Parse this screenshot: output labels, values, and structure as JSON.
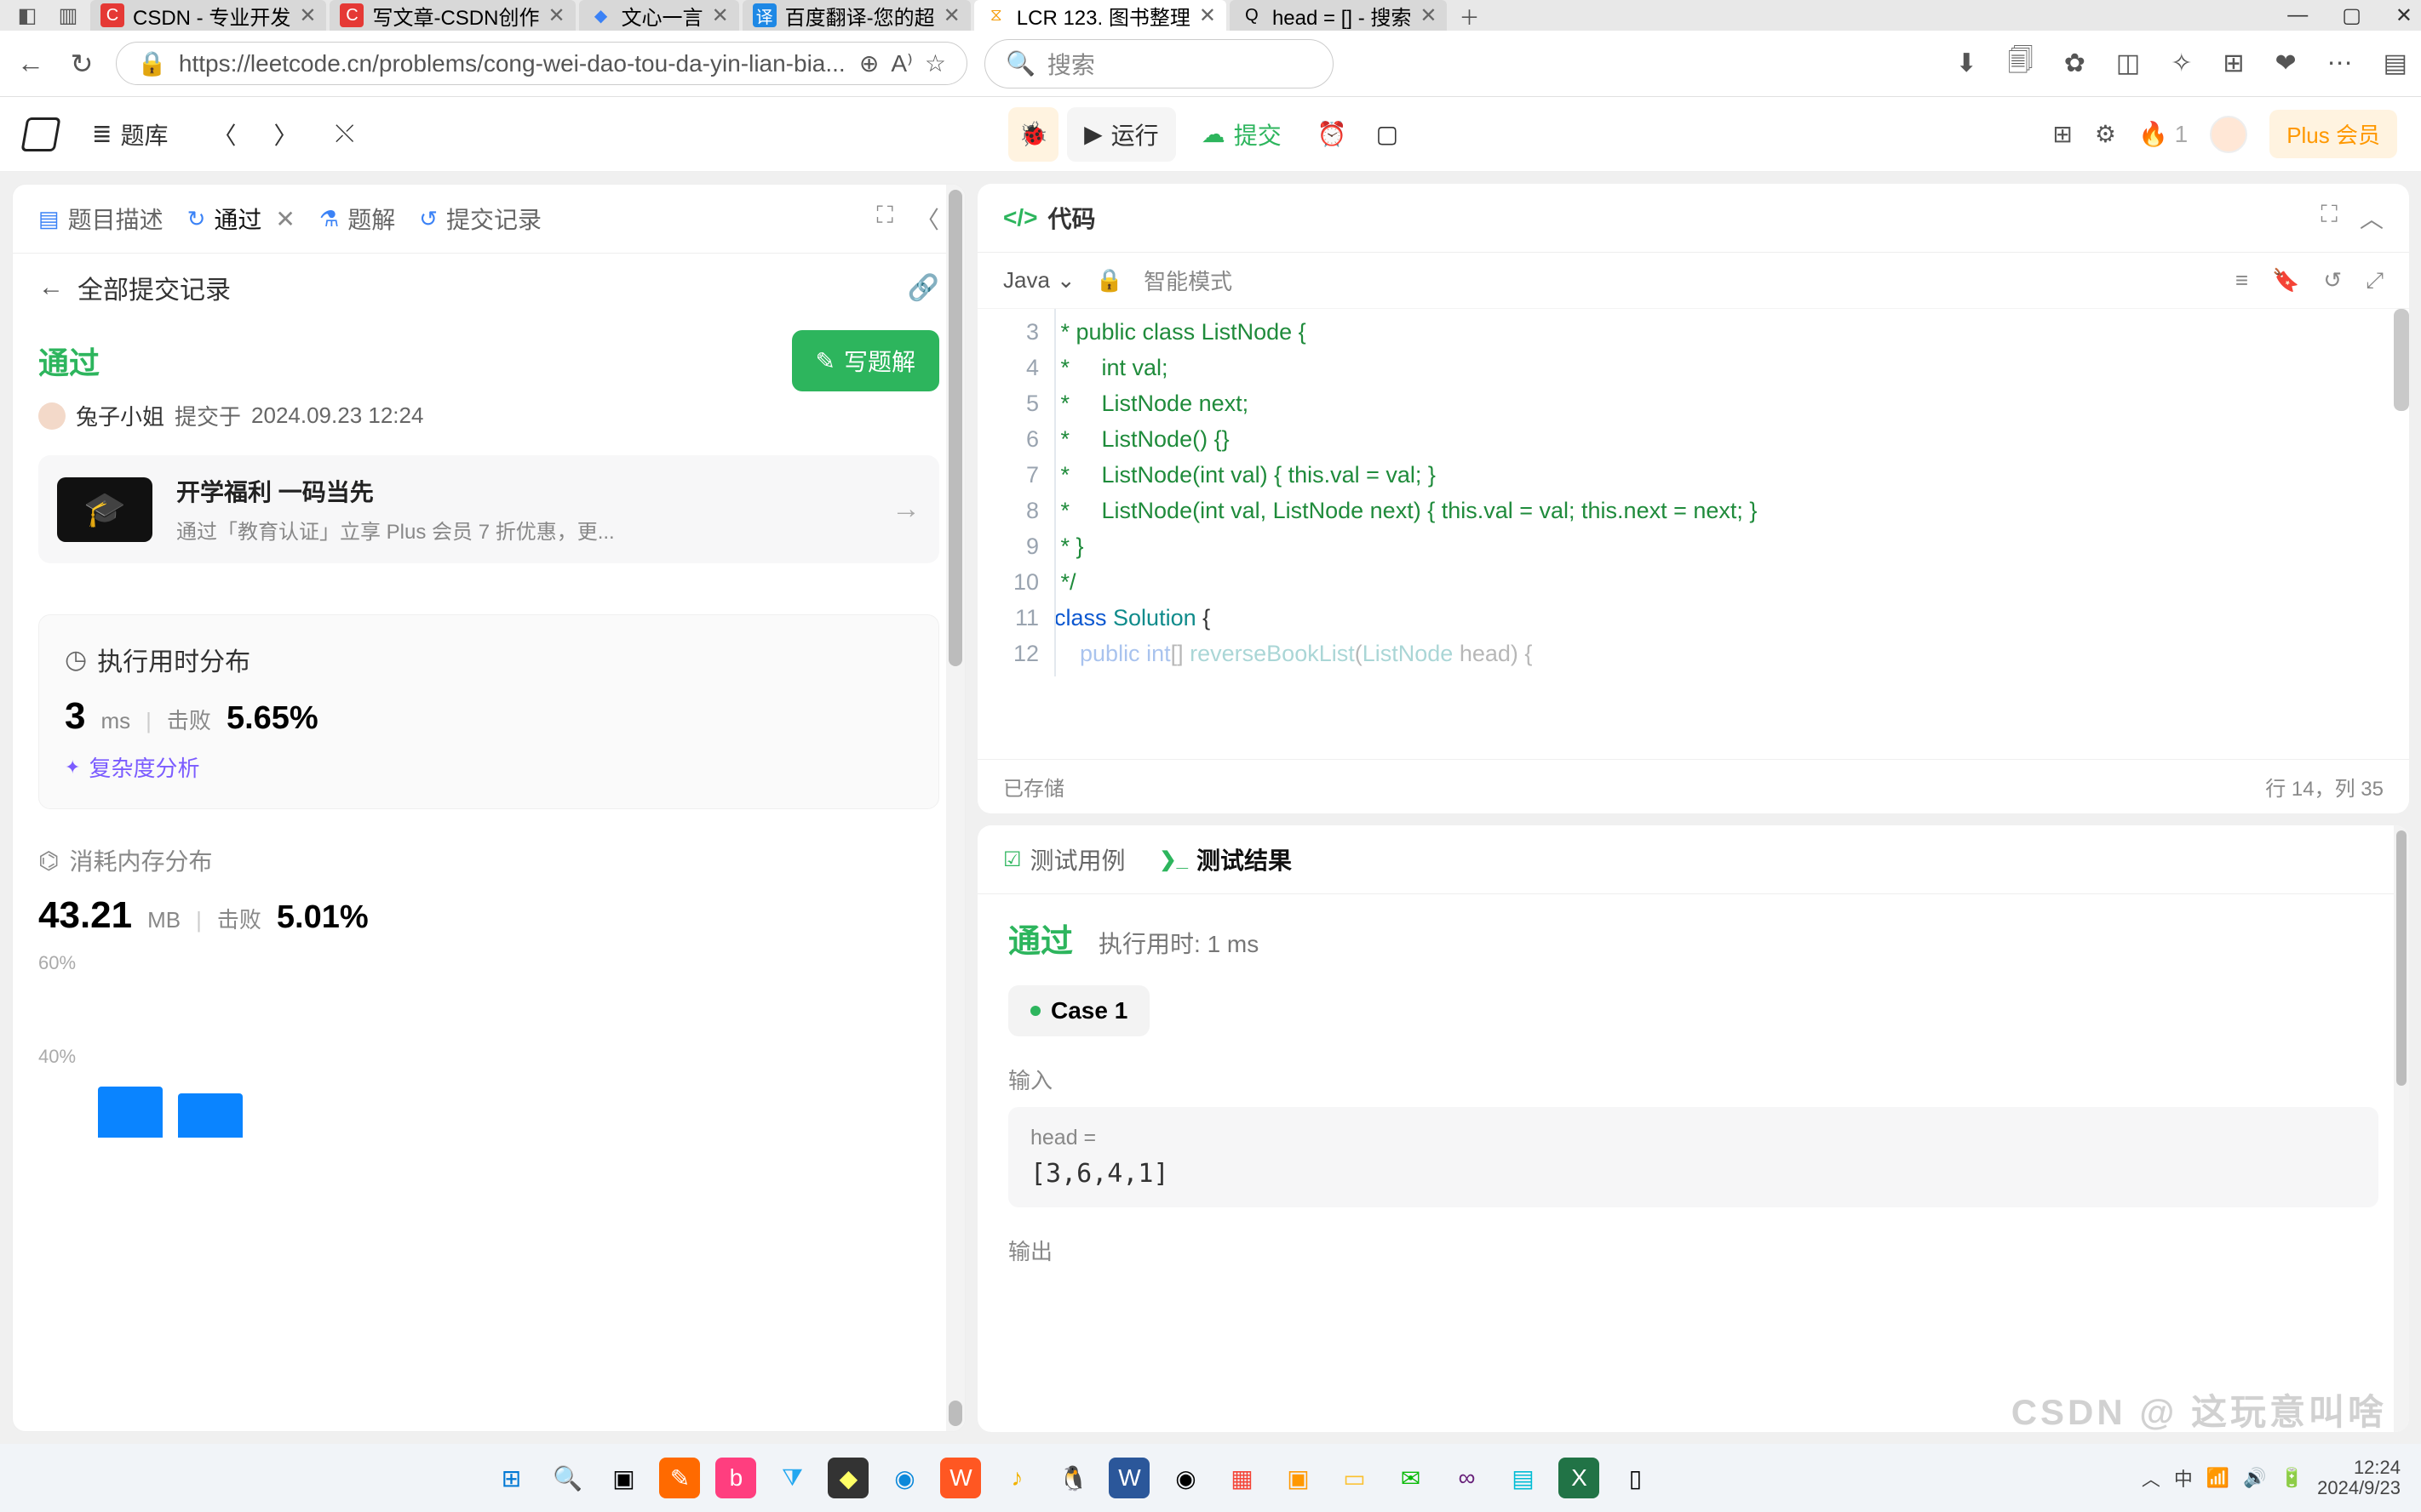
{
  "browser": {
    "tabs": [
      {
        "favicon": "C",
        "favcolor": "#e53935",
        "title": "CSDN - 专业开发"
      },
      {
        "favicon": "C",
        "favcolor": "#e53935",
        "title": "写文章-CSDN创作"
      },
      {
        "favicon": "◆",
        "favcolor": "#3b82f6",
        "title": "文心一言"
      },
      {
        "favicon": "译",
        "favcolor": "#1e88e5",
        "title": "百度翻译-您的超"
      },
      {
        "favicon": "⧖",
        "favcolor": "#f59e0b",
        "title": "LCR 123. 图书整理",
        "active": true
      },
      {
        "favicon": "Q",
        "favcolor": "#555",
        "title": "head = [] - 搜索"
      }
    ],
    "url": "https://leetcode.cn/problems/cong-wei-dao-tou-da-yin-lian-bia...",
    "search_placeholder": "搜索"
  },
  "appbar": {
    "problems": "题库",
    "run": "运行",
    "submit": "提交",
    "fire_count": "1",
    "plus": "Plus 会员"
  },
  "left": {
    "tabs": {
      "desc": "题目描述",
      "passed": "通过",
      "solution": "题解",
      "history": "提交记录"
    },
    "sub_header": "全部提交记录",
    "pass_title": "通过",
    "write_solution": "写题解",
    "user": "兔子小姐",
    "submitted_at_label": "提交于",
    "submitted_at": "2024.09.23 12:24",
    "promo": {
      "title": "开学福利 一码当先",
      "sub": "通过「教育认证」立享 Plus 会员 7 折优惠，更..."
    },
    "runtime": {
      "header": "执行用时分布",
      "value": "3",
      "unit": "ms",
      "beat_label": "击败",
      "beat_pct": "5.65%",
      "complexity": "复杂度分析"
    },
    "memory": {
      "header": "消耗内存分布",
      "value": "43.21",
      "unit": "MB",
      "beat_label": "击败",
      "beat_pct": "5.01%",
      "axis": [
        "60%",
        "40%"
      ],
      "bars": [
        60,
        52
      ]
    }
  },
  "code": {
    "header": "代码",
    "language": "Java",
    "smart_mode": "智能模式",
    "lines_start": 3,
    "lines": [
      " * public class ListNode {",
      " *     int val;",
      " *     ListNode next;",
      " *     ListNode() {}",
      " *     ListNode(int val) { this.val = val; }",
      " *     ListNode(int val, ListNode next) { this.val = val; this.next = next; }",
      " * }",
      " */",
      "class Solution {",
      "    public int[] reverseBookList(ListNode head) {"
    ],
    "status_saved": "已存储",
    "cursor": "行 14，列 35"
  },
  "results": {
    "tab_cases": "测试用例",
    "tab_results": "测试结果",
    "pass": "通过",
    "runtime_label": "执行用时: 1 ms",
    "case": "Case 1",
    "input_label": "输入",
    "input_var": "head =",
    "input_val": "[3,6,4,1]",
    "output_label": "输出"
  },
  "tray": {
    "ime": "中",
    "time": "12:24",
    "date": "2024/9/23"
  }
}
